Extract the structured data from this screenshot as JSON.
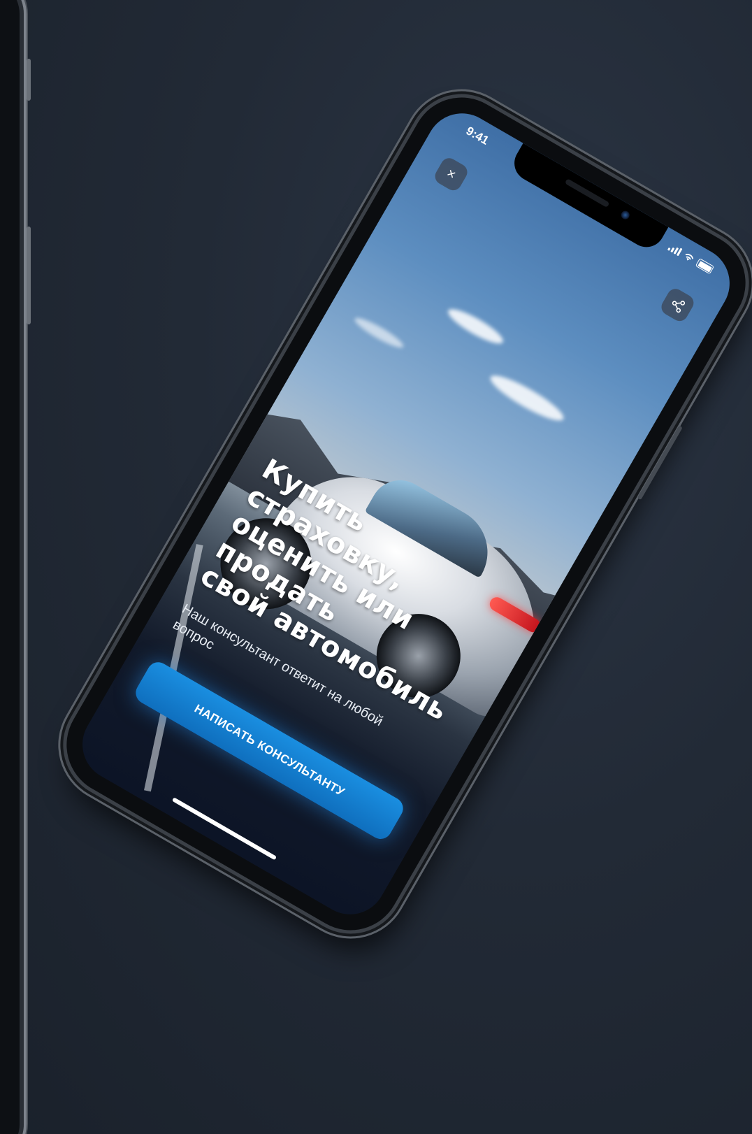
{
  "status_bar": {
    "time": "9:41",
    "icons": [
      "signal-icon",
      "wifi-icon",
      "battery-icon"
    ]
  },
  "toolbar": {
    "close_icon": "close-icon",
    "close_glyph": "×",
    "share_icon": "share-icon"
  },
  "hero": {
    "headline": "Купить страховку,\nоценить или продать\nсвой автомобиль",
    "subtitle": "Наш консультант ответит на любой вопрос"
  },
  "cta": {
    "label": "Написать консультанту"
  },
  "colors": {
    "accent": "#1a8ee0",
    "background": "#1f2733"
  }
}
